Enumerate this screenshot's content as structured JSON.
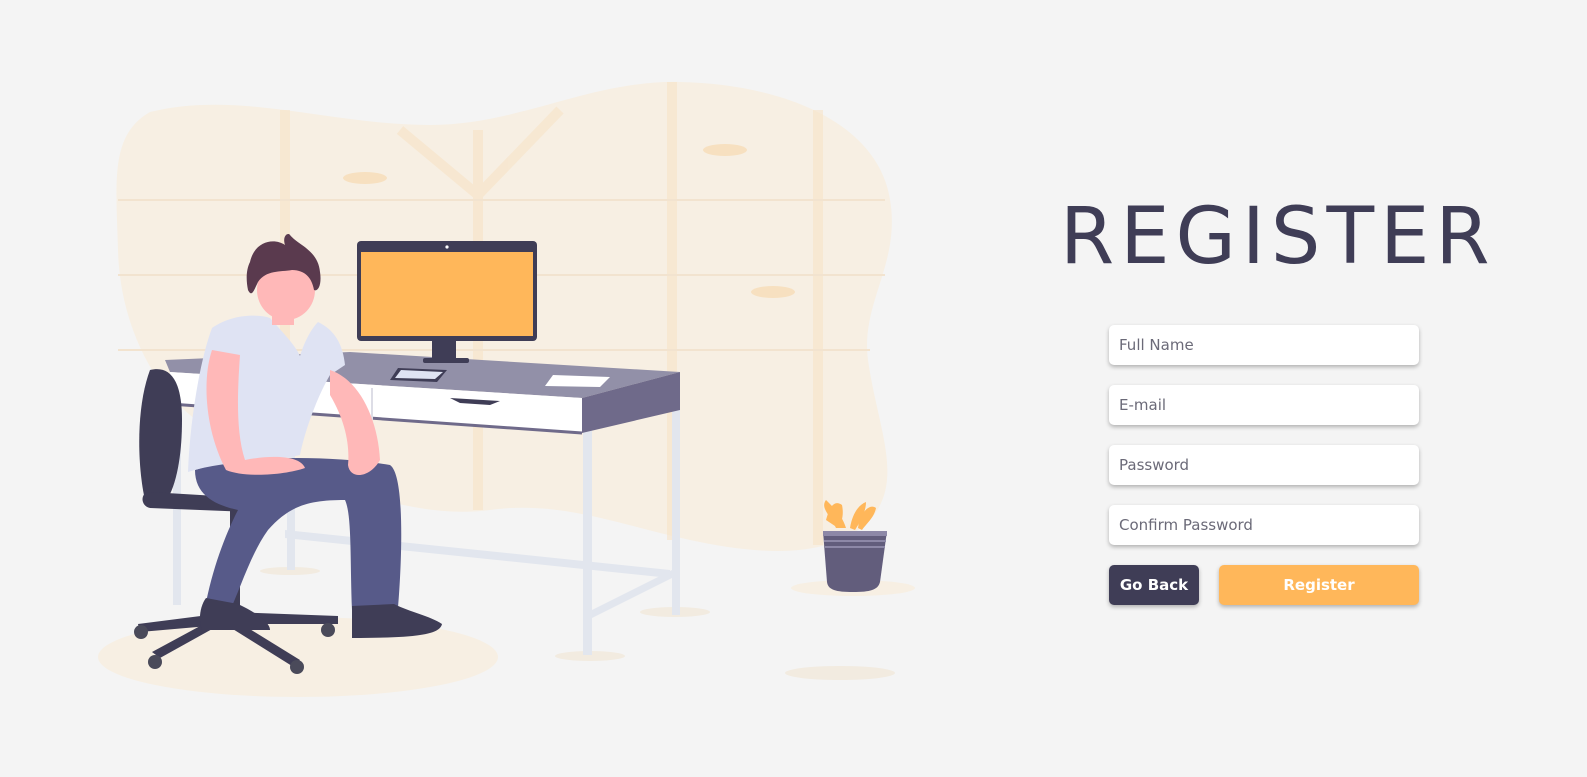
{
  "page": {
    "title": "REGISTER"
  },
  "form": {
    "fields": [
      {
        "placeholder": "Full Name",
        "type": "text"
      },
      {
        "placeholder": "E-mail",
        "type": "email"
      },
      {
        "placeholder": "Password",
        "type": "password"
      },
      {
        "placeholder": "Confirm Password",
        "type": "password"
      }
    ],
    "go_back_label": "Go Back",
    "register_label": "Register"
  },
  "colors": {
    "primary_dark": "#3f3d56",
    "accent": "#ffb75a",
    "background": "#f4f4f4",
    "blob": "#f7efe3"
  },
  "illustration": {
    "description_icon": "man-at-desk-illustration"
  }
}
